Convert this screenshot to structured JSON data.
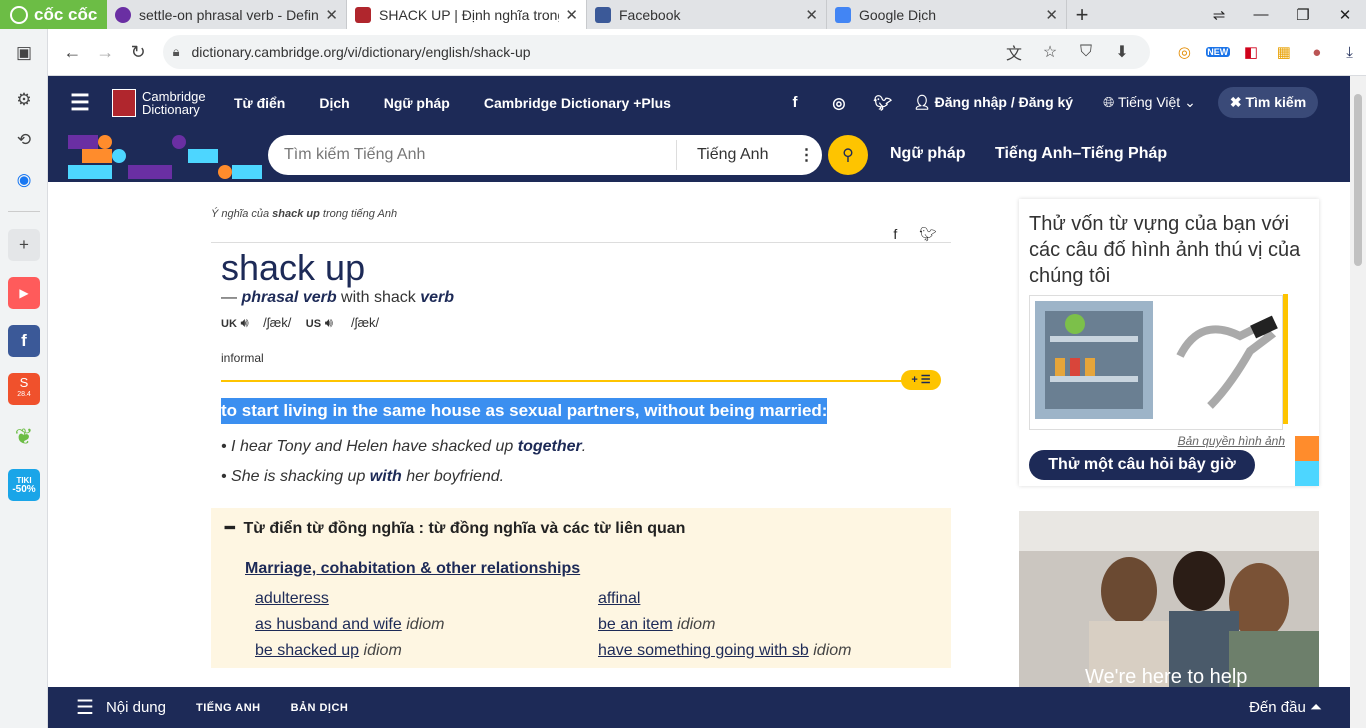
{
  "browser": {
    "brand": "cốc cốc",
    "tabs": [
      {
        "title": "settle-on phrasal verb - Defin",
        "color": "#6a2fa3",
        "active": false
      },
      {
        "title": "SHACK UP | Định nghĩa trong",
        "color": "#b0262d",
        "active": true
      },
      {
        "title": "Facebook",
        "color": "#3b5998",
        "active": false
      },
      {
        "title": "Google Dịch",
        "color": "#4285f4",
        "active": false
      }
    ],
    "url": "dictionary.cambridge.org/vi/dictionary/english/shack-up",
    "ext_new_badge": "NEW"
  },
  "header": {
    "logo_line1": "Cambridge",
    "logo_line2": "Dictionary",
    "nav": [
      "Từ điển",
      "Dịch",
      "Ngữ pháp",
      "Cambridge Dictionary +Plus"
    ],
    "login": "Đăng nhập / Đăng ký",
    "language": "Tiếng Việt",
    "search_toggle": "Tìm kiếm"
  },
  "search": {
    "placeholder": "Tìm kiếm Tiếng Anh",
    "lang": "Tiếng Anh",
    "link1": "Ngữ pháp",
    "link2": "Tiếng Anh–Tiếng Pháp"
  },
  "entry": {
    "crumb_pre": "Ý nghĩa của ",
    "crumb_word": "shack up",
    "crumb_post": " trong tiếng Anh",
    "headword": "shack up",
    "pos_dash": "— ",
    "pos": "phrasal verb",
    "pos_with": " with shack ",
    "pos_verb": "verb",
    "uk": "UK",
    "uk_ipa": "/ʃæk/",
    "us": "US",
    "us_ipa": "/ʃæk/",
    "usage": "informal",
    "definition": "to start living in the same house as sexual partners, without being married:",
    "examples": [
      {
        "a": "I hear Tony and Helen have shacked up ",
        "b": "together",
        "c": "."
      },
      {
        "a": "She is shacking up ",
        "b": "with",
        "c": " her boyfriend."
      }
    ]
  },
  "thesaurus": {
    "heading": "Từ điển từ đồng nghĩa : từ đồng nghĩa và các từ liên quan",
    "category": "Marriage, cohabitation & other relationships",
    "items": [
      {
        "w": "adulteress",
        "tag": ""
      },
      {
        "w": "affinal",
        "tag": ""
      },
      {
        "w": "as husband and wife",
        "tag": "idiom"
      },
      {
        "w": "be an item",
        "tag": "idiom"
      },
      {
        "w": "be shacked up",
        "tag": "idiom"
      },
      {
        "w": "have something going with sb",
        "tag": "idiom"
      }
    ]
  },
  "sidebar": {
    "quiz_title": "Thử vốn từ vựng của bạn với các câu đố hình ảnh thú vị của chúng tôi",
    "credit": "Bản quyền hình ảnh",
    "quiz_button": "Thử một câu hỏi bây giờ",
    "promo_caption": "We're here to help"
  },
  "bottom": {
    "menu": "Nội dung",
    "tab1": "TIẾNG ANH",
    "tab2": "BẢN DỊCH",
    "top": "Đến đầu"
  },
  "left_sidebar": {
    "tiki_label": "TIKI",
    "tiki_discount": "-50%",
    "shopee_badge": "28.4"
  }
}
